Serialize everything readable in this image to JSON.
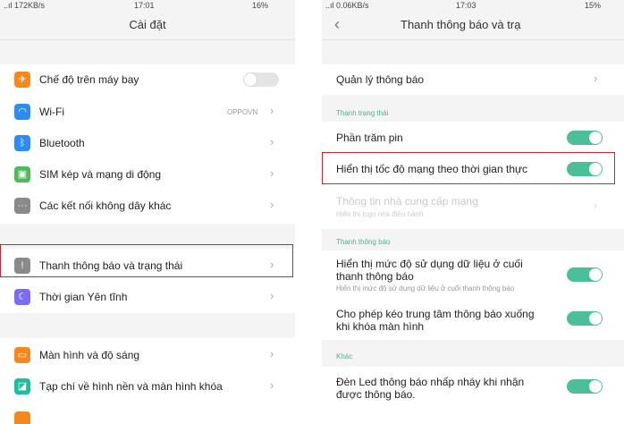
{
  "left": {
    "status": {
      "signal": "..ıl 172KB/s",
      "time": "17:01",
      "battery": "16%"
    },
    "title": "Cài đặt",
    "items": [
      {
        "label": "Chế độ trên máy bay",
        "icon": "airplane-icon",
        "color": "#f5871f"
      },
      {
        "label": "Wi-Fi",
        "value": "OPPOVN",
        "icon": "wifi-icon",
        "color": "#2d8cf0"
      },
      {
        "label": "Bluetooth",
        "icon": "bluetooth-icon",
        "color": "#2d8cf0"
      },
      {
        "label": "SIM kép và mạng di động",
        "icon": "sim-icon",
        "color": "#4cbb5a"
      },
      {
        "label": "Các kết nối không dây khác",
        "icon": "more-connections-icon",
        "color": "#8a8a8a"
      },
      {
        "label": "Thanh thông báo và trạng thái",
        "icon": "notification-icon",
        "color": "#8a8a8a"
      },
      {
        "label": "Thời gian Yên tĩnh",
        "icon": "moon-icon",
        "color": "#7b6cf0"
      },
      {
        "label": "Màn hình và độ sáng",
        "icon": "display-icon",
        "color": "#f5871f"
      },
      {
        "label": "Tạp chí về hình nền và màn hình khóa",
        "icon": "wallpaper-icon",
        "color": "#1dbf9f"
      }
    ]
  },
  "right": {
    "status": {
      "signal": "..ıl 0.06KB/s",
      "time": "17:03",
      "battery": "15%"
    },
    "title": "Thanh thông báo và trạ",
    "manage": "Quản lý thông báo",
    "section_status": "Thanh trạng thái",
    "battery_percent": "Phần trăm pin",
    "realtime_speed": "Hiển thị tốc độ mạng theo thời gian thực",
    "carrier_info": "Thông tin nhà cung cấp mạng",
    "carrier_sub": "Hiển thị logo nhà điều hành",
    "section_notification": "Thanh thông báo",
    "data_usage_l1": "Hiển thị mức độ sử dụng dữ liệu ở cuối",
    "data_usage_l2": "thanh thông báo",
    "data_usage_sub": "Hiển thị mức độ sử dụng dữ liệu ở cuối thanh thông báo",
    "lockscreen_l1": "Cho phép kéo trung tâm thông báo xuống",
    "lockscreen_l2": "khi khóa màn hình",
    "section_other": "Khác",
    "led_l1": "Đèn Led thông báo nhấp nháy khi nhận",
    "led_l2": "được thông báo."
  },
  "colors": {
    "accent": "#4bbf9a",
    "highlight": "#d01f2a"
  }
}
